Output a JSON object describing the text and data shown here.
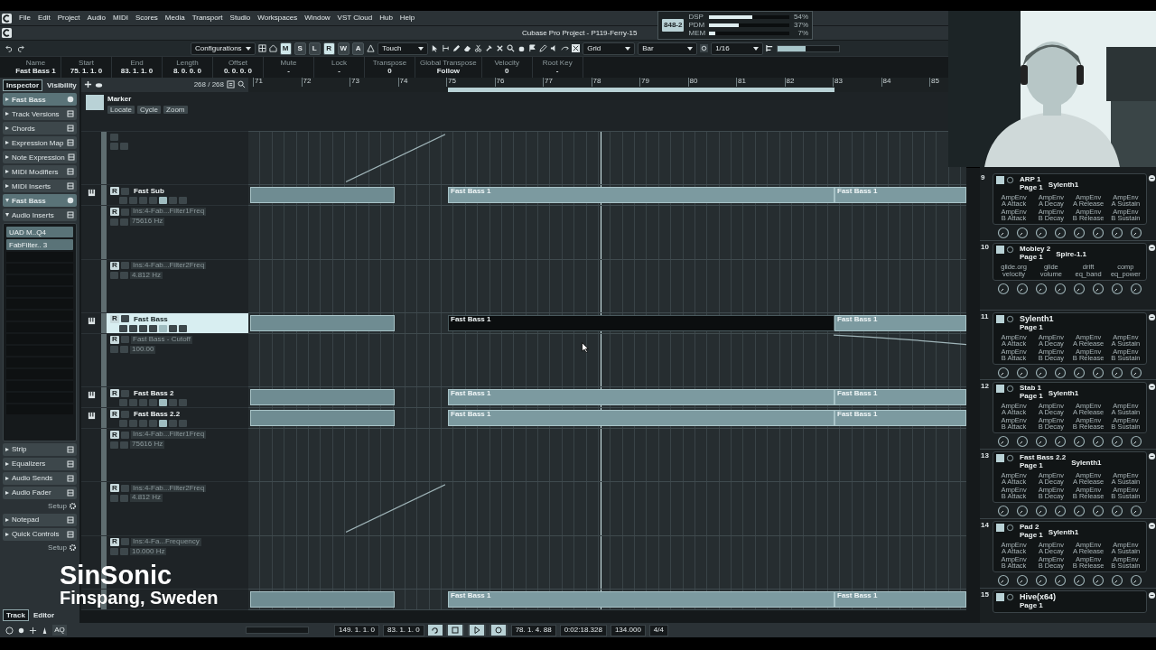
{
  "menu": [
    "File",
    "Edit",
    "Project",
    "Audio",
    "MIDI",
    "Scores",
    "Media",
    "Transport",
    "Studio",
    "Workspaces",
    "Window",
    "VST Cloud",
    "Hub",
    "Help"
  ],
  "window": {
    "title": "Cubase Pro Project - P119-Ferry-15"
  },
  "performance": {
    "badge": "848-2",
    "meters": [
      {
        "label": "DSP",
        "level": 0.54,
        "reading": "54%"
      },
      {
        "label": "PDM",
        "level": 0.37,
        "reading": "37%"
      },
      {
        "label": "MEM",
        "level": 0.07,
        "reading": "7%"
      }
    ]
  },
  "toolbar": {
    "configurations": "Configurations",
    "modes": [
      {
        "label": "M",
        "on": true
      },
      {
        "label": "S",
        "on": false
      },
      {
        "label": "L",
        "on": false
      },
      {
        "label": "R",
        "on": true
      },
      {
        "label": "W",
        "on": false
      },
      {
        "label": "A",
        "on": false
      }
    ],
    "automation_mode": "Touch",
    "snap_type": "Grid",
    "grid_type": "Bar",
    "quantize": "1/16",
    "meter": {
      "level": 0.45
    }
  },
  "info_line": [
    {
      "label": "Name",
      "value": "Fast Bass 1"
    },
    {
      "label": "Start",
      "value": "75. 1. 1. 0"
    },
    {
      "label": "End",
      "value": "83. 1. 1. 0"
    },
    {
      "label": "Length",
      "value": "8. 0. 0. 0"
    },
    {
      "label": "Offset",
      "value": "0. 0. 0. 0"
    },
    {
      "label": "Mute",
      "value": "-"
    },
    {
      "label": "Lock",
      "value": "-"
    },
    {
      "label": "Transpose",
      "value": "0"
    },
    {
      "label": "Global Transpose",
      "value": "Follow"
    },
    {
      "label": "Velocity",
      "value": "0"
    },
    {
      "label": "Root Key",
      "value": "-"
    }
  ],
  "inspector": {
    "tabs": [
      {
        "label": "Inspector",
        "selected": true
      },
      {
        "label": "Visibility",
        "selected": false
      }
    ],
    "sections": [
      {
        "kind": "track",
        "label": "Fast Bass",
        "expanded": false
      },
      {
        "kind": "section",
        "label": "Track Versions",
        "expanded": false
      },
      {
        "kind": "section",
        "label": "Chords",
        "expanded": false
      },
      {
        "kind": "section",
        "label": "Expression Map",
        "expanded": false
      },
      {
        "kind": "section",
        "label": "Note Expression",
        "expanded": false
      },
      {
        "kind": "section",
        "label": "MIDI Modifiers",
        "expanded": false
      },
      {
        "kind": "section",
        "label": "MIDI Inserts",
        "expanded": false
      },
      {
        "kind": "track",
        "label": "Fast Bass",
        "expanded": true
      },
      {
        "kind": "section",
        "label": "Audio Inserts",
        "expanded": true,
        "inserts": [
          "UAD M..Q4",
          "FabFilter.. 3"
        ]
      },
      {
        "kind": "section",
        "label": "Strip",
        "expanded": false
      },
      {
        "kind": "section",
        "label": "Equalizers",
        "expanded": false
      },
      {
        "kind": "section",
        "label": "Audio Sends",
        "expanded": false
      },
      {
        "kind": "section",
        "label": "Audio Fader",
        "expanded": false
      },
      {
        "kind": "setup",
        "label": "Setup"
      },
      {
        "kind": "section",
        "label": "Notepad",
        "expanded": false
      },
      {
        "kind": "section",
        "label": "Quick Controls",
        "expanded": false
      },
      {
        "kind": "setup",
        "label": "Setup"
      }
    ],
    "bottom_tabs": [
      {
        "label": "Track",
        "selected": true
      },
      {
        "label": "Editor",
        "selected": false
      }
    ]
  },
  "track_list": {
    "count": "268 / 268",
    "marker": {
      "name": "Marker",
      "buttons": [
        "Locate",
        "Cycle",
        "Zoom"
      ]
    },
    "rows": [
      {
        "kind": "lane",
        "curve": {
          "kind": "rising"
        }
      },
      {
        "kind": "track",
        "name": "Fast Sub",
        "read": "R",
        "selected": false,
        "events": [
          "Fast Bass 1",
          "Fast Bass 1"
        ]
      },
      {
        "kind": "lane",
        "read": "R",
        "parameter": "Ins:4-Fab...Filter1Freq",
        "value": "75616 Hz"
      },
      {
        "kind": "lane",
        "read": "R",
        "parameter": "Ins:4-Fab...Filter2Freq",
        "value": "4.812 Hz"
      },
      {
        "kind": "track",
        "name": "Fast Bass",
        "read": "R",
        "selected": true,
        "events": [
          "Fast Bass 1",
          "Fast Bass 1"
        ]
      },
      {
        "kind": "lane",
        "read": "R",
        "parameter": "Fast Bass - Cutoff",
        "value": "100.00",
        "curve": {
          "kind": "falling"
        }
      },
      {
        "kind": "track",
        "name": "Fast Bass 2",
        "read": "R",
        "selected": false,
        "events": [
          "Fast Bass 1",
          "Fast Bass 1"
        ]
      },
      {
        "kind": "track",
        "name": "Fast Bass 2.2",
        "read": "R",
        "selected": false,
        "events": [
          "Fast Bass 1",
          "Fast Bass 1"
        ]
      },
      {
        "kind": "lane",
        "read": "R",
        "parameter": "Ins:4-Fab...Filter1Freq",
        "value": "75616 Hz"
      },
      {
        "kind": "lane",
        "read": "R",
        "parameter": "Ins:4-Fab...Filter2Freq",
        "value": "4.812 Hz",
        "curve": {
          "kind": "rising"
        }
      },
      {
        "kind": "lane",
        "read": "R",
        "parameter": "Ins:4-Fa...Frequency",
        "value": "10.000 Hz"
      },
      {
        "kind": "track",
        "selected": false,
        "events": [
          "Fast Bass 1",
          "Fast Bass 1"
        ]
      }
    ]
  },
  "ruler": {
    "bars": [
      "71",
      "72",
      "73",
      "74",
      "75",
      "76",
      "77",
      "78",
      "79",
      "80",
      "81",
      "82",
      "83",
      "84",
      "85"
    ]
  },
  "rack": {
    "slots": [
      {
        "number": "9",
        "title": "ARP 1",
        "plugin": "Sylenth1",
        "page": "Page 1",
        "kind": "knobs",
        "params": [
          {
            "group": "AmpEnv",
            "name": "A Attack"
          },
          {
            "group": "AmpEnv",
            "name": "A Decay"
          },
          {
            "group": "AmpEnv",
            "name": "A Release"
          },
          {
            "group": "AmpEnv",
            "name": "A Sustain"
          },
          {
            "group": "AmpEnv",
            "name": "B Attack"
          },
          {
            "group": "AmpEnv",
            "name": "B Decay"
          },
          {
            "group": "AmpEnv",
            "name": "B Release"
          },
          {
            "group": "AmpEnv",
            "name": "B Sustain"
          }
        ]
      },
      {
        "number": "10",
        "title": "Mobley 2",
        "plugin": "Spire-1.1",
        "page": "Page 1",
        "kind": "knobs",
        "params": [
          {
            "name": "glide.org"
          },
          {
            "name": "glide"
          },
          {
            "name": "drift"
          },
          {
            "name": "comp"
          },
          {
            "name": "velocity"
          },
          {
            "name": "volume"
          },
          {
            "name": "eq_band"
          },
          {
            "name": "eq_power"
          }
        ]
      },
      {
        "number": "11",
        "title": "Sylenth1",
        "page": "Page 1",
        "kind": "knobs",
        "params": [
          {
            "group": "AmpEnv",
            "name": "A Attack"
          },
          {
            "group": "AmpEnv",
            "name": "A Decay"
          },
          {
            "group": "AmpEnv",
            "name": "A Release"
          },
          {
            "group": "AmpEnv",
            "name": "A Sustain"
          },
          {
            "group": "AmpEnv",
            "name": "B Attack"
          },
          {
            "group": "AmpEnv",
            "name": "B Decay"
          },
          {
            "group": "AmpEnv",
            "name": "B Release"
          },
          {
            "group": "AmpEnv",
            "name": "B Sustain"
          }
        ]
      },
      {
        "number": "12",
        "title": "Stab 1",
        "plugin": "Sylenth1",
        "page": "Page 1",
        "kind": "knobs",
        "params": [
          {
            "group": "AmpEnv",
            "name": "A Attack"
          },
          {
            "group": "AmpEnv",
            "name": "A Decay"
          },
          {
            "group": "AmpEnv",
            "name": "A Release"
          },
          {
            "group": "AmpEnv",
            "name": "A Sustain"
          },
          {
            "group": "AmpEnv",
            "name": "B Attack"
          },
          {
            "group": "AmpEnv",
            "name": "B Decay"
          },
          {
            "group": "AmpEnv",
            "name": "B Release"
          },
          {
            "group": "AmpEnv",
            "name": "B Sustain"
          }
        ]
      },
      {
        "number": "13",
        "title": "Fast Bass 2.2",
        "plugin": "Sylenth1",
        "page": "Page 1",
        "kind": "knobs",
        "params": [
          {
            "group": "AmpEnv",
            "name": "A Attack"
          },
          {
            "group": "AmpEnv",
            "name": "A Decay"
          },
          {
            "group": "AmpEnv",
            "name": "A Release"
          },
          {
            "group": "AmpEnv",
            "name": "A Sustain"
          },
          {
            "group": "AmpEnv",
            "name": "B Attack"
          },
          {
            "group": "AmpEnv",
            "name": "B Decay"
          },
          {
            "group": "AmpEnv",
            "name": "B Release"
          },
          {
            "group": "AmpEnv",
            "name": "B Sustain"
          }
        ]
      },
      {
        "number": "14",
        "title": "Pad 2",
        "plugin": "Sylenth1",
        "page": "Page 1",
        "kind": "knobs",
        "params": [
          {
            "group": "AmpEnv",
            "name": "A Attack"
          },
          {
            "group": "AmpEnv",
            "name": "A Decay"
          },
          {
            "group": "AmpEnv",
            "name": "A Release"
          },
          {
            "group": "AmpEnv",
            "name": "A Sustain"
          },
          {
            "group": "AmpEnv",
            "name": "B Attack"
          },
          {
            "group": "AmpEnv",
            "name": "B Decay"
          },
          {
            "group": "AmpEnv",
            "name": "B Release"
          },
          {
            "group": "AmpEnv",
            "name": "B Sustain"
          }
        ]
      },
      {
        "number": "15",
        "title": "Hive(x64)",
        "page": "Page 1",
        "kind": "cut"
      }
    ]
  },
  "transport": {
    "quantize_label": "AQ",
    "left_locator": "149. 1. 1. 0",
    "right_locator": "83. 1. 1. 0",
    "cycle": true,
    "primary_time": "78. 1. 4. 88",
    "secondary_time": "0:02:18.328",
    "tempo": "134.000",
    "signature": "4/4"
  },
  "webcam": {
    "kind": "picture"
  },
  "caption": {
    "title": "SinSonic",
    "subtitle": "Finspang, Sweden"
  }
}
